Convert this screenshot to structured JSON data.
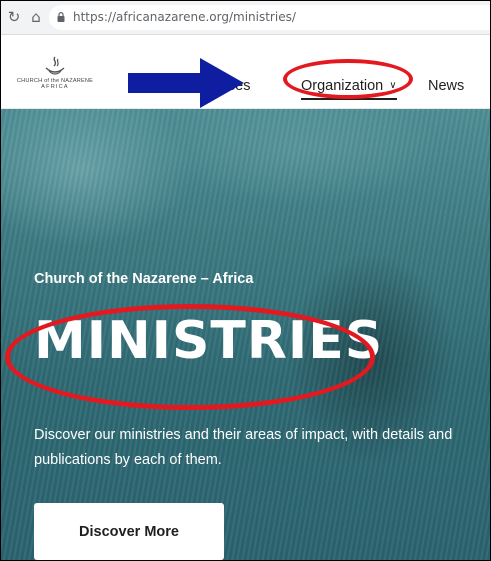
{
  "browser": {
    "url": "https://africanazarene.org/ministries/"
  },
  "header": {
    "logo": {
      "line1": "CHURCH of the NAZARENE",
      "line2": "AFRICA"
    },
    "nav": {
      "resources": "urces",
      "organization": "Organization",
      "news": "News"
    }
  },
  "hero": {
    "subtitle": "Church of the Nazarene – Africa",
    "title": "MINISTRIES",
    "description": "Discover our ministries and their areas of impact, with details and publications by each of them.",
    "button_label": "Discover More"
  },
  "colors": {
    "annotation_red": "#e3191f",
    "annotation_arrow": "#0f1ea0",
    "hero_teal": "#3d7a82"
  },
  "icons": {
    "reload": "reload-icon",
    "home": "home-icon",
    "lock": "lock-icon",
    "chevron": "chevron-down-icon",
    "logo": "flame-logo-icon"
  }
}
